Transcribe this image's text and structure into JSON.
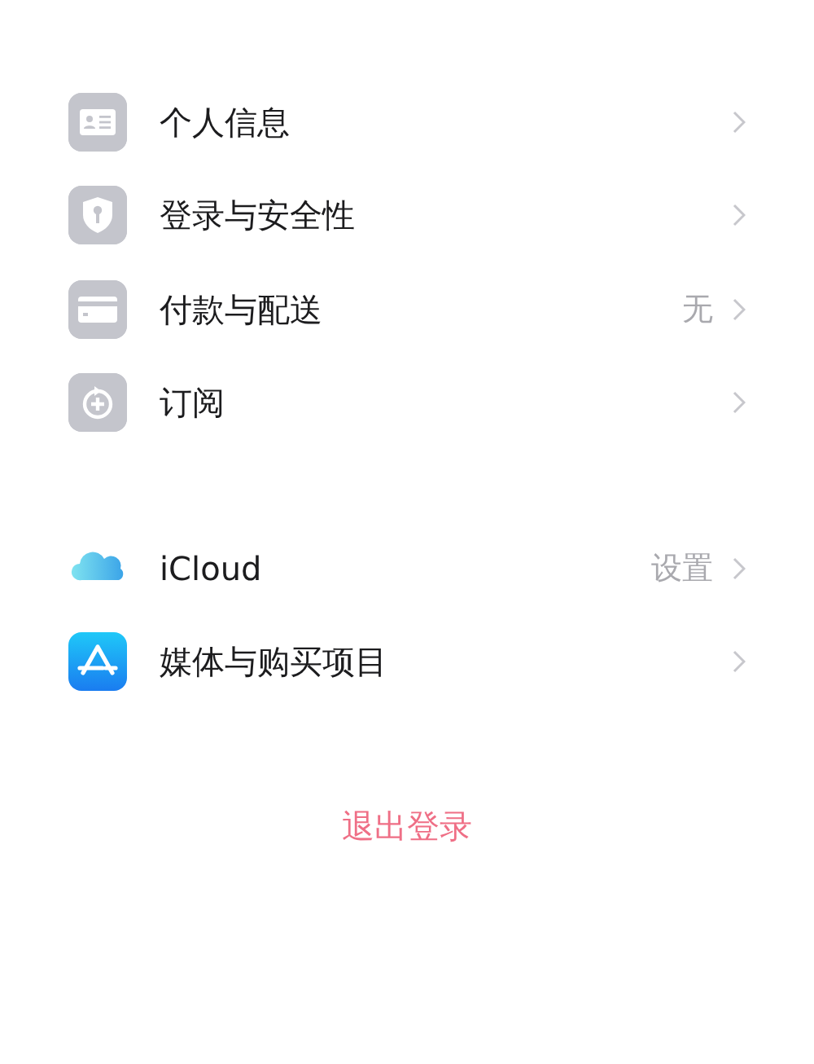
{
  "groups": [
    {
      "items": [
        {
          "kind": "id-card",
          "label": "个人信息"
        },
        {
          "kind": "shield",
          "label": "登录与安全性"
        },
        {
          "kind": "card",
          "label": "付款与配送",
          "detail": "无"
        },
        {
          "kind": "subscription",
          "label": "订阅"
        }
      ]
    },
    {
      "items": [
        {
          "kind": "cloud",
          "label": "iCloud",
          "detail": "设置"
        },
        {
          "kind": "store",
          "label": "媒体与购买项目"
        }
      ]
    }
  ],
  "sign_out": "退出登录"
}
